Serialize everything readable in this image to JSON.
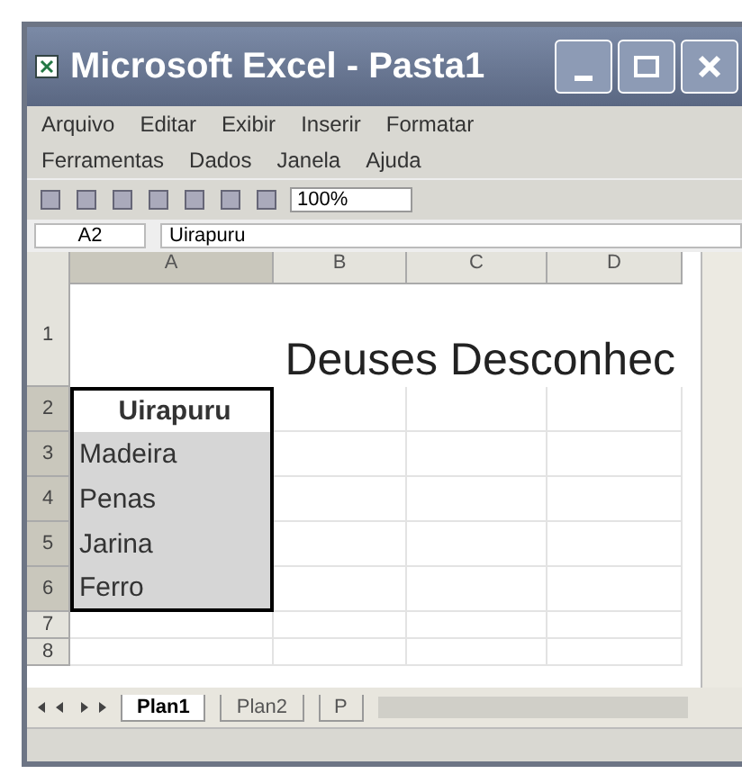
{
  "window": {
    "title": "Microsoft Excel - Pasta1"
  },
  "menu_rows": [
    {
      "items": [
        "Arquivo",
        "Editar",
        "Exibir",
        "Inserir",
        "Formatar"
      ]
    },
    {
      "items": [
        "Ferramentas",
        "Dados",
        "Janela",
        "Ajuda"
      ]
    }
  ],
  "toolbar": {
    "zoom": "100%"
  },
  "formula_bar": {
    "name_box": "A2",
    "value": "Uirapuru"
  },
  "columns": [
    {
      "label": "A",
      "selected": true
    },
    {
      "label": "B",
      "selected": false
    },
    {
      "label": "C",
      "selected": false
    },
    {
      "label": "D",
      "selected": false
    }
  ],
  "rows": [
    {
      "header": "1",
      "title": "Deuses Desconhec",
      "selected": false
    },
    {
      "header": "2",
      "cell": "Uirapuru",
      "selected": true,
      "active": true
    },
    {
      "header": "3",
      "cell": "Madeira",
      "selected": true,
      "active": false
    },
    {
      "header": "4",
      "cell": "Penas",
      "selected": true,
      "active": false
    },
    {
      "header": "5",
      "cell": "Jarina",
      "selected": true,
      "active": false
    },
    {
      "header": "6",
      "cell": "Ferro",
      "selected": true,
      "active": false
    },
    {
      "header": "7",
      "selected": false
    },
    {
      "header": "8",
      "selected": false
    }
  ],
  "sheet_tabs": [
    {
      "label": "Plan1",
      "selected": true
    },
    {
      "label": "Plan2",
      "selected": false
    },
    {
      "label": "P",
      "selected": false
    }
  ]
}
